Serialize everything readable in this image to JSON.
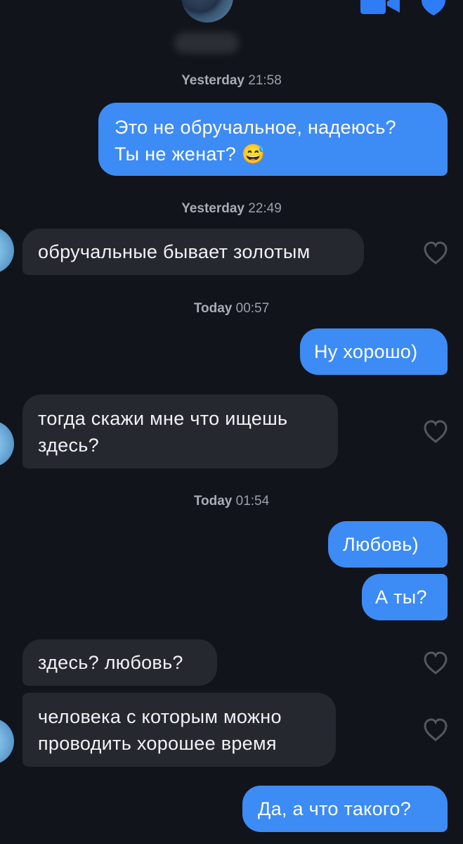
{
  "timestamps": [
    {
      "day": "Yesterday",
      "time": "21:58"
    },
    {
      "day": "Yesterday",
      "time": "22:49"
    },
    {
      "day": "Today",
      "time": "00:57"
    },
    {
      "day": "Today",
      "time": "01:54"
    }
  ],
  "messages": [
    {
      "direction": "outgoing",
      "lines": [
        "Это не обручальное, надеюсь?",
        "Ты не женат? 😅"
      ]
    },
    {
      "direction": "incoming",
      "lines": [
        "обручальные бывает золотым"
      ]
    },
    {
      "direction": "outgoing",
      "lines": [
        "Ну хорошо)"
      ]
    },
    {
      "direction": "incoming",
      "lines": [
        "тогда скажи мне что ищешь",
        "здесь?"
      ]
    },
    {
      "direction": "outgoing",
      "lines": [
        "Любовь)"
      ]
    },
    {
      "direction": "outgoing",
      "lines": [
        "А ты?"
      ]
    },
    {
      "direction": "incoming",
      "lines": [
        "здесь? любовь?"
      ]
    },
    {
      "direction": "incoming",
      "lines": [
        "человека с которым можно",
        "проводить хорошее время"
      ]
    },
    {
      "direction": "outgoing",
      "lines": [
        "Да, а что такого?"
      ]
    }
  ],
  "icons": {
    "header": [
      "video-call-icon",
      "shield-icon"
    ],
    "reaction": "heart-icon"
  },
  "colors": {
    "background": "#12141b",
    "outgoing_bubble": "#3d8bf5",
    "incoming_bubble": "#262830",
    "accent_icon": "#2e7cf6"
  }
}
